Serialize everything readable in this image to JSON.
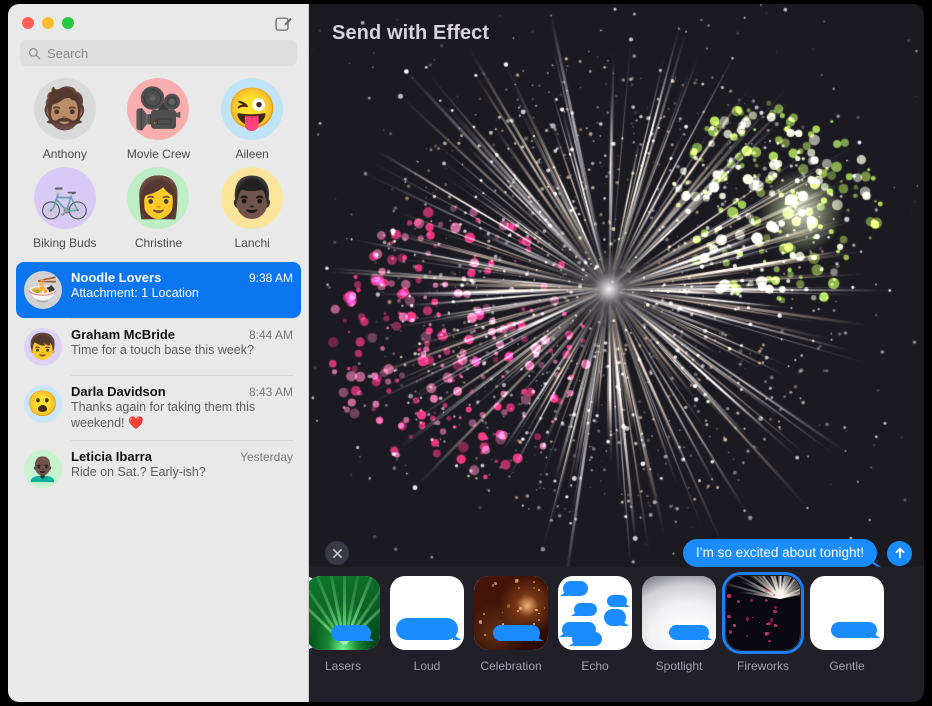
{
  "window": {
    "traffic_lights": [
      "close",
      "minimize",
      "zoom"
    ],
    "compose_icon": "compose-icon"
  },
  "sidebar": {
    "search": {
      "placeholder": "Search",
      "value": "",
      "icon": "search-icon"
    },
    "pinned": [
      {
        "name": "Anthony",
        "glyph": "🧔🏽",
        "bg": "#d9d9d9"
      },
      {
        "name": "Movie Crew",
        "glyph": "🎥",
        "bg": "#f8aeae"
      },
      {
        "name": "Aileen",
        "glyph": "😜",
        "bg": "#bfe4f6"
      },
      {
        "name": "Biking Buds",
        "glyph": "🚲",
        "bg": "#d9c9f7"
      },
      {
        "name": "Christine",
        "glyph": "👩",
        "bg": "#bdeec6"
      },
      {
        "name": "Lanchi",
        "glyph": "👨🏿",
        "bg": "#fbe59a"
      }
    ],
    "conversations": [
      {
        "name": "Noodle Lovers",
        "time": "9:38 AM",
        "preview": "Attachment: 1 Location",
        "glyph": "🍜",
        "bg": "#d2d2d2",
        "selected": true
      },
      {
        "name": "Graham McBride",
        "time": "8:44 AM",
        "preview": "Time for a touch base this week?",
        "glyph": "👦",
        "bg": "#ddd2f6",
        "selected": false
      },
      {
        "name": "Darla Davidson",
        "time": "8:43 AM",
        "preview": "Thanks again for taking them this weekend! ❤️",
        "glyph": "😮",
        "bg": "#c9e7f8",
        "selected": false
      },
      {
        "name": "Leticia Ibarra",
        "time": "Yesterday",
        "preview": "Ride on Sat.? Early-ish?",
        "glyph": "👨🏿‍🦲",
        "bg": "#c6f2ce",
        "selected": false
      }
    ]
  },
  "main": {
    "title": "Send with Effect",
    "close_icon": "close-icon",
    "message": {
      "text": "I’m so excited about tonight!",
      "send_icon": "send-arrow-icon"
    },
    "effects": [
      {
        "label": "",
        "style": "plain-clipped",
        "selected": false
      },
      {
        "label": "Lasers",
        "style": "lasers",
        "selected": false
      },
      {
        "label": "Loud",
        "style": "loud",
        "selected": false
      },
      {
        "label": "Celebration",
        "style": "celebration",
        "selected": false
      },
      {
        "label": "Echo",
        "style": "echo",
        "selected": false
      },
      {
        "label": "Spotlight",
        "style": "spotlight",
        "selected": false
      },
      {
        "label": "Fireworks",
        "style": "fireworks",
        "selected": true
      },
      {
        "label": "Gentle",
        "style": "gentle",
        "selected": false
      }
    ]
  },
  "colors": {
    "accent_blue": "#1b8cfe",
    "selection_blue": "#0b76ef",
    "sidebar_bg": "#e9e9e9",
    "panel_bg": "#191820",
    "tray_bg": "#211f28"
  }
}
